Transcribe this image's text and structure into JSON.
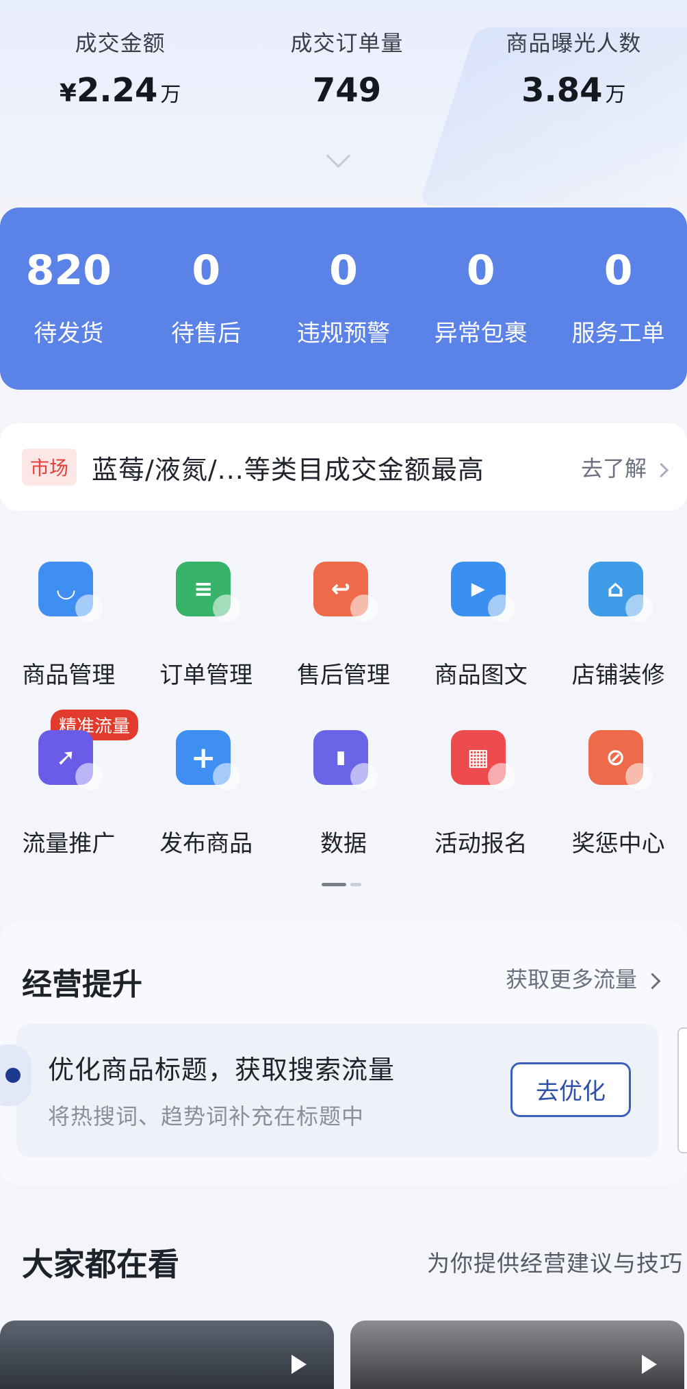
{
  "stats": [
    {
      "label": "成交金额",
      "currency": "¥",
      "value": "2.24",
      "unit": "万"
    },
    {
      "label": "成交订单量",
      "currency": "",
      "value": "749",
      "unit": ""
    },
    {
      "label": "商品曝光人数",
      "currency": "",
      "value": "3.84",
      "unit": "万"
    }
  ],
  "status": [
    {
      "value": "820",
      "label": "待发货"
    },
    {
      "value": "0",
      "label": "待售后"
    },
    {
      "value": "0",
      "label": "违规预警"
    },
    {
      "value": "0",
      "label": "异常包裹"
    },
    {
      "value": "0",
      "label": "服务工单"
    }
  ],
  "market": {
    "tag": "市场",
    "text": "蓝莓/液氮/...等类目成交金额最高",
    "link": "去了解"
  },
  "grid": {
    "row1": [
      {
        "label": "商品管理",
        "icon": "shopping-bag-icon",
        "color": "#3f8ef2",
        "glyph": "◡"
      },
      {
        "label": "订单管理",
        "icon": "order-list-icon",
        "color": "#37b46a",
        "glyph": "≡"
      },
      {
        "label": "售后管理",
        "icon": "return-icon",
        "color": "#ee6a4a",
        "glyph": "↩"
      },
      {
        "label": "商品图文",
        "icon": "video-play-icon",
        "color": "#3b8ff0",
        "glyph": "▶"
      },
      {
        "label": "店铺装修",
        "icon": "storefront-icon",
        "color": "#3e9be8",
        "glyph": "⌂"
      }
    ],
    "row2": [
      {
        "label": "流量推广",
        "icon": "rocket-icon",
        "color": "#6b5ce8",
        "glyph": "➚",
        "badge": "精准流量"
      },
      {
        "label": "发布商品",
        "icon": "plus-icon",
        "color": "#3f8ef2",
        "glyph": "+"
      },
      {
        "label": "数据",
        "icon": "bar-chart-icon",
        "color": "#6a64e6",
        "glyph": "▮"
      },
      {
        "label": "活动报名",
        "icon": "calendar-icon",
        "color": "#ee4b4f",
        "glyph": "▦"
      },
      {
        "label": "奖惩中心",
        "icon": "forbidden-icon",
        "color": "#ee6a4a",
        "glyph": "⊘"
      }
    ]
  },
  "improve": {
    "title": "经营提升",
    "more": "获取更多流量",
    "task_title": "优化商品标题，获取搜索流量",
    "task_sub": "将热搜词、趋势词补充在标题中",
    "task_btn": "去优化"
  },
  "watch": {
    "title": "大家都在看",
    "sub": "为你提供经营建议与技巧"
  }
}
